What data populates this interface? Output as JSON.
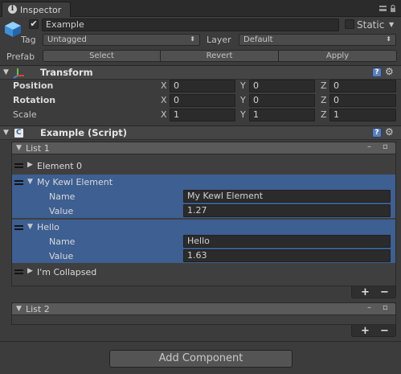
{
  "window": {
    "tab_label": "Inspector"
  },
  "gameobject": {
    "name": "Example",
    "static_label": "Static",
    "tag_label": "Tag",
    "tag_value": "Untagged",
    "layer_label": "Layer",
    "layer_value": "Default",
    "prefab_label": "Prefab",
    "prefab_buttons": {
      "select": "Select",
      "revert": "Revert",
      "apply": "Apply"
    }
  },
  "transform": {
    "title": "Transform",
    "rows": [
      {
        "label": "Position",
        "x": "0",
        "y": "0",
        "z": "0"
      },
      {
        "label": "Rotation",
        "x": "0",
        "y": "0",
        "z": "0"
      },
      {
        "label": "Scale",
        "x": "1",
        "y": "1",
        "z": "1"
      }
    ],
    "axis": {
      "x": "X",
      "y": "Y",
      "z": "Z"
    }
  },
  "script": {
    "title": "Example (Script)",
    "list1": {
      "title": "List 1",
      "header_buttons": {
        "minus": "–",
        "square": "▫"
      },
      "elements": [
        {
          "label": "Element 0"
        },
        {
          "label": "My Kewl Element",
          "name_label": "Name",
          "name_value": "My Kewl Element",
          "value_label": "Value",
          "value_value": "1.27"
        },
        {
          "label": "Hello",
          "name_label": "Name",
          "name_value": "Hello",
          "value_label": "Value",
          "value_value": "1.63"
        },
        {
          "label": "I'm Collapsed"
        }
      ]
    },
    "list2": {
      "title": "List 2"
    },
    "footer": {
      "plus": "+",
      "minus": "−"
    }
  },
  "add_component_label": "Add Component"
}
